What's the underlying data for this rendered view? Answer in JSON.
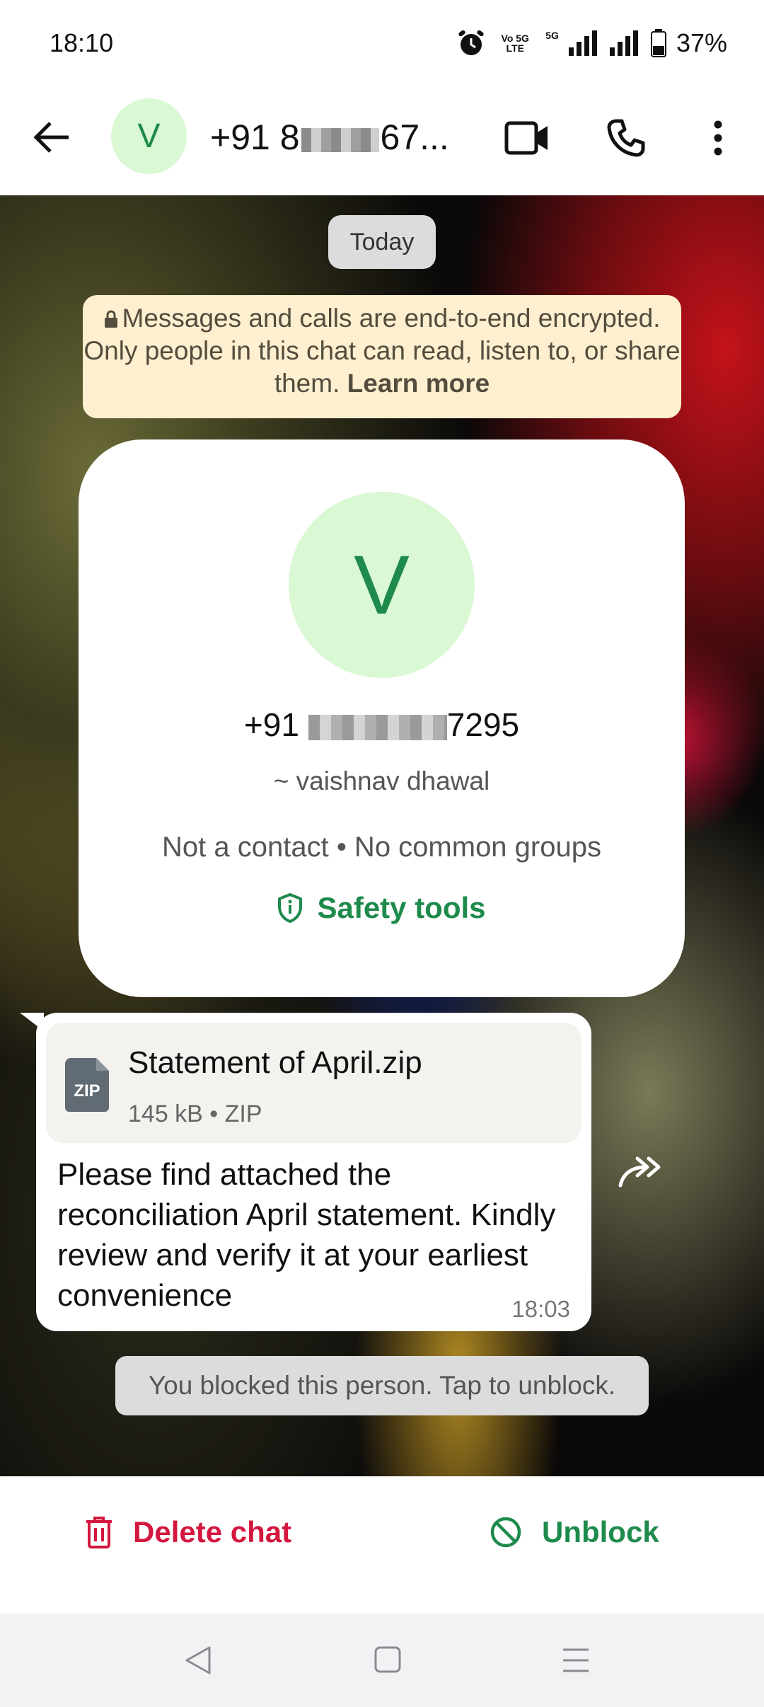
{
  "status_bar": {
    "time": "18:10",
    "network_label_1": "Vo 5G LTE",
    "network_label_2": "5G",
    "battery": "37%"
  },
  "header": {
    "avatar_letter": "V",
    "title_prefix": "+91 8",
    "title_suffix": "67..."
  },
  "chat": {
    "date_chip": "Today",
    "encryption": {
      "text": "Messages and calls are end-to-end encrypted. Only people in this chat can read, listen to, or share them.",
      "link": "Learn more"
    },
    "contact_card": {
      "avatar_letter": "V",
      "phone_prefix": "+91",
      "phone_suffix": "7295",
      "name": "~ vaishnav dhawal",
      "info": "Not a contact • No common groups",
      "safety_label": "Safety tools"
    },
    "message": {
      "attachment_icon_label": "ZIP",
      "file_name": "Statement of April.zip",
      "file_meta": "145 kB • ZIP",
      "text": "Please find attached the reconciliation April statement. Kindly review and verify it at your earliest convenience",
      "time": "18:03"
    },
    "blocked_notice": "You blocked this person. Tap to unblock."
  },
  "actions": {
    "delete_label": "Delete chat",
    "unblock_label": "Unblock"
  },
  "colors": {
    "green": "#1e8a4c",
    "red": "#d3173e",
    "avatar_bg": "#d9f8d3"
  }
}
